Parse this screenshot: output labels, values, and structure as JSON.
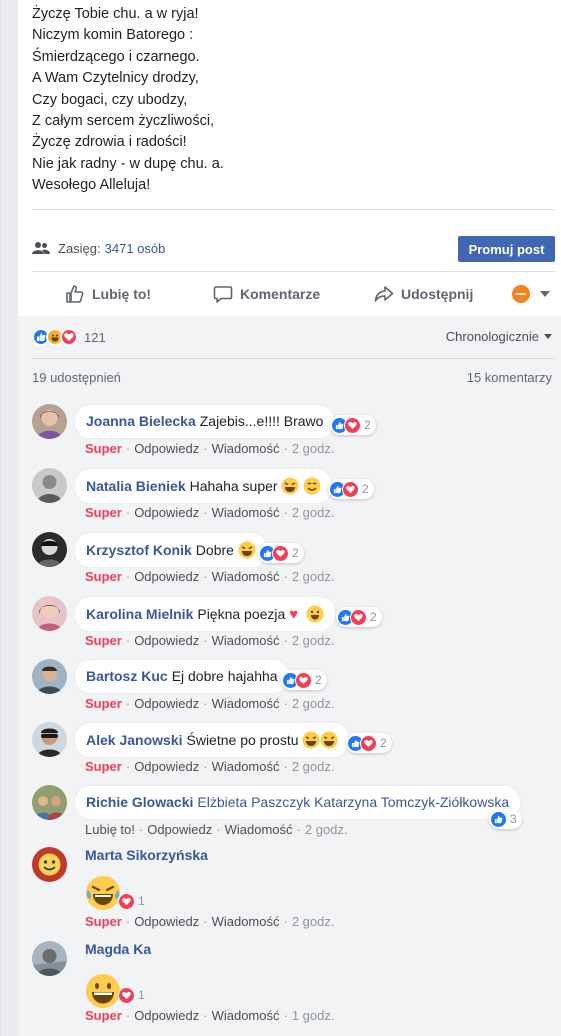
{
  "post": {
    "poem": [
      "Życzę Tobie chu. a w ryja!",
      "Niczym komin Batorego :",
      "Śmierdzącego i czarnego.",
      "A Wam Czytelnicy drodzy,",
      "Czy bogaci, czy ubodzy,",
      "Z całym sercem życzliwości,",
      "Życzę zdrowia i radości!",
      "Nie jak radny - w dupę chu. a.",
      "Wesołego Alleluja!"
    ],
    "reach_label": "Zasięg:",
    "reach_value": "3471 osób",
    "promote_label": "Promuj post"
  },
  "actions": {
    "like": "Lubię to!",
    "comment": "Komentarze",
    "share": "Udostępnij"
  },
  "summary": {
    "reaction_count": "121",
    "sort_label": "Chronologicznie",
    "shares": "19 udostępnień",
    "comments": "15 komentarzy"
  },
  "labels": {
    "super": "Super",
    "like": "Lubię to!",
    "reply": "Odpowiedz",
    "message": "Wiadomość"
  },
  "comments": [
    {
      "name": "Joanna Bielecka",
      "text": "Zajebis...e!!!! Brawo",
      "reactions": "2",
      "time": "2 godz."
    },
    {
      "name": "Natalia Bieniek",
      "text": "Hahaha super",
      "reactions": "2",
      "time": "2 godz."
    },
    {
      "name": "Krzysztof Konik",
      "text": "Dobre",
      "reactions": "2",
      "time": "2 godz."
    },
    {
      "name": "Karolina Mielnik",
      "text": "Piękna poezja",
      "reactions": "2",
      "time": "2 godz."
    },
    {
      "name": "Bartosz Kuc",
      "text": "Ej dobre hajahha",
      "reactions": "2",
      "time": "2 godz."
    },
    {
      "name": "Alek Janowski",
      "text": "Świetne po prostu",
      "reactions": "2",
      "time": "2 godz."
    },
    {
      "name": "Richie Glowacki",
      "text": "Elżbieta Paszczyk Katarzyna Tomczyk-Ziółkowska",
      "reactions": "3",
      "time": "2 godz."
    },
    {
      "name": "Marta Sikorzyńska",
      "text": "",
      "reactions": "1",
      "time": "2 godz."
    },
    {
      "name": "Magda Ka",
      "text": "",
      "reactions": "1",
      "time": "1 godz."
    }
  ],
  "colors": {
    "link": "#385898",
    "super": "#f33e58",
    "button": "#4267b2",
    "like_blue": "#2078f4",
    "love_red": "#f33e58",
    "haha_yellow": "#f7b125"
  }
}
